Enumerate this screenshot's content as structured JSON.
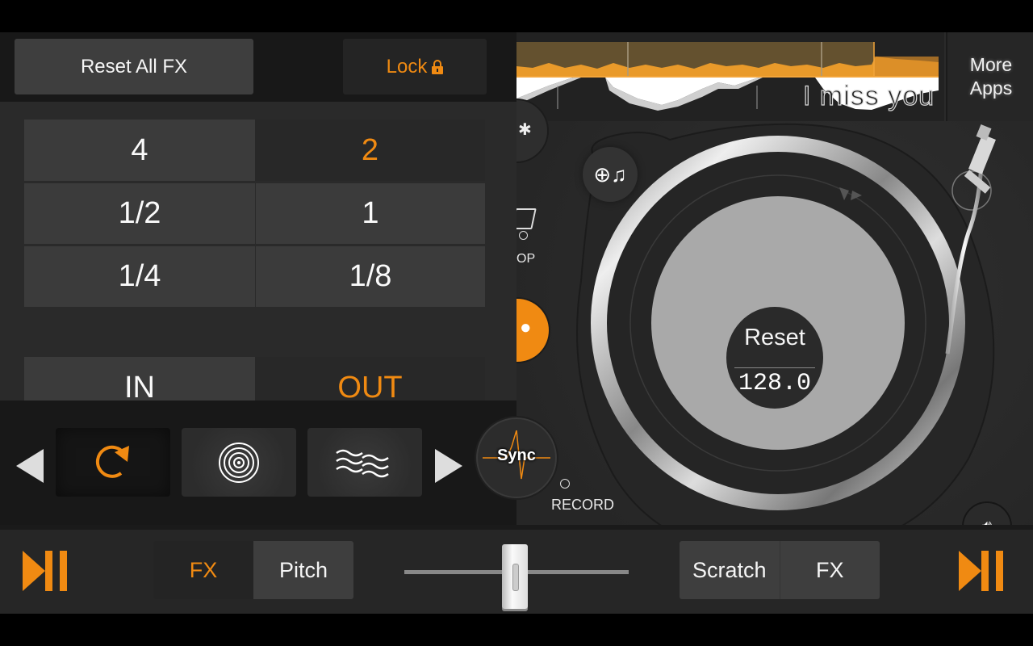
{
  "fx_panel": {
    "reset_all_label": "Reset All FX",
    "lock_label": "Lock",
    "lock_icon": "padlock-icon",
    "beat_grid": [
      {
        "label": "4",
        "selected": false
      },
      {
        "label": "2",
        "selected": true
      },
      {
        "label": "1/2",
        "selected": false
      },
      {
        "label": "1",
        "selected": false
      },
      {
        "label": "1/4",
        "selected": false
      },
      {
        "label": "1/8",
        "selected": false
      }
    ],
    "in_label": "IN",
    "out_label": "OUT",
    "out_active": true,
    "effects": [
      {
        "icon": "loop-roll-icon",
        "selected": true
      },
      {
        "icon": "vinyl-rings-icon",
        "selected": false
      },
      {
        "icon": "waves-icon",
        "selected": false
      }
    ],
    "prev_icon": "triangle-left-icon",
    "next_icon": "triangle-right-icon"
  },
  "waveform": {
    "track_title": "I miss you"
  },
  "more_apps": {
    "line1": "More",
    "line2": "Apps"
  },
  "deck": {
    "sync_label": "Sync",
    "record_label": "RECORD",
    "loop_label_partial": "OP",
    "turntable_reset_label": "Reset",
    "bpm": "128.0",
    "add_music_icon": "add-music-icon",
    "volume_icon": "speaker-icon",
    "settings_icon": "gear-icon"
  },
  "bottom_bar": {
    "left_mode": {
      "fx": "FX",
      "pitch": "Pitch",
      "active": "FX"
    },
    "right_mode": {
      "scratch": "Scratch",
      "fx": "FX",
      "active": "none"
    },
    "crossfader_position": 0.5
  },
  "colors": {
    "accent": "#f08a12",
    "panel": "#181818",
    "button": "#3e3e3e"
  }
}
